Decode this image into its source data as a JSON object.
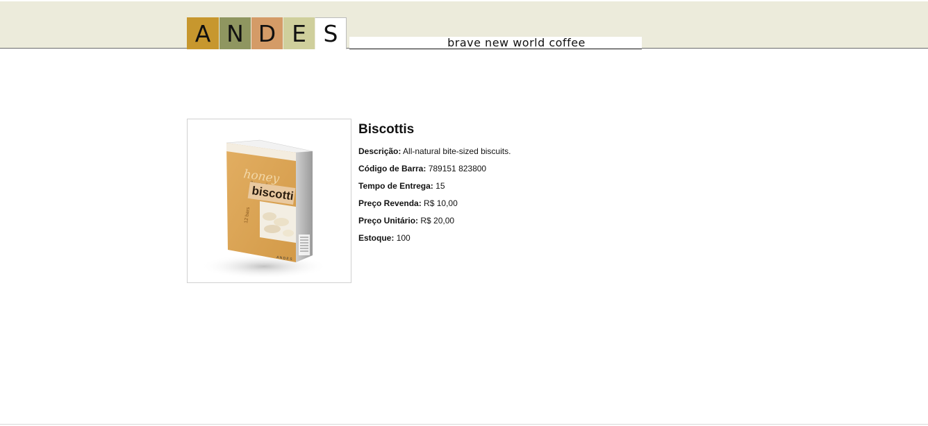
{
  "header": {
    "logo_letters": [
      "A",
      "N",
      "D",
      "E",
      "S"
    ],
    "tagline": "brave new world coffee"
  },
  "product": {
    "title": "Biscottis",
    "image_text": {
      "brand_script": "honey",
      "flavored": "flavored",
      "name": "biscotti",
      "count": "12 bars",
      "brand_small": "A N D E S"
    },
    "fields": [
      {
        "label": "Descrição:",
        "value": "All-natural bite-sized biscuits."
      },
      {
        "label": "Código de Barra:",
        "value": "789151 823800"
      },
      {
        "label": "Tempo de Entrega:",
        "value": "15"
      },
      {
        "label": "Preço Revenda:",
        "value": "R$ 10,00"
      },
      {
        "label": "Preço Unitário:",
        "value": "R$ 20,00"
      },
      {
        "label": "Estoque:",
        "value": "100"
      }
    ]
  },
  "colors": {
    "header_bg": "#ecebdb",
    "tile_a": "#c7972e",
    "tile_n": "#8f9660",
    "tile_d": "#d49b67",
    "tile_e": "#cfcf9c",
    "tile_s": "#ffffff",
    "box_orange": "#dba354"
  }
}
